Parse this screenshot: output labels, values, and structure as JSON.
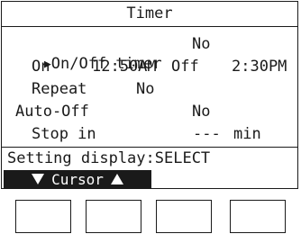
{
  "screen": {
    "title": "Timer",
    "cursor_glyph": "▶",
    "rows": {
      "onoff_label": "On/Off timer",
      "onoff_value": "No",
      "on_label": "On",
      "on_time": "12:50AM",
      "off_label": "Off",
      "off_time": "2:30PM",
      "repeat_label": "Repeat",
      "repeat_value": "No",
      "autooff_label": "Auto-Off",
      "autooff_value": "No",
      "stopin_label": "Stop in",
      "stopin_value": "---",
      "stopin_unit": "min"
    },
    "hint": "Setting display:SELECT",
    "cursor_bar_label": "Cursor"
  },
  "function_buttons": [
    "F1",
    "F2",
    "F3",
    "F4"
  ]
}
